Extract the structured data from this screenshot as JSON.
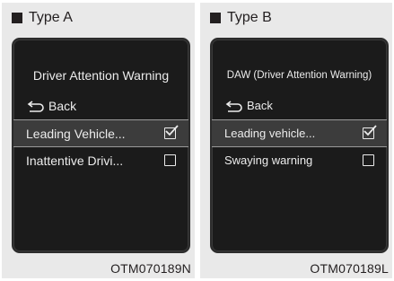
{
  "panels": [
    {
      "type_label": "Type A",
      "screen": {
        "title": "Driver Attention Warning",
        "back_label": "Back",
        "items": [
          {
            "label": "Leading Vehicle...",
            "checked": true,
            "selected": true
          },
          {
            "label": "Inattentive Drivi...",
            "checked": false,
            "selected": false
          }
        ]
      },
      "code": "OTM070189N"
    },
    {
      "type_label": "Type B",
      "screen": {
        "title": "DAW (Driver Attention Warning)",
        "back_label": "Back",
        "items": [
          {
            "label": "Leading vehicle...",
            "checked": true,
            "selected": true
          },
          {
            "label": "Swaying warning",
            "checked": false,
            "selected": false
          }
        ]
      },
      "code": "OTM070189L"
    }
  ],
  "colors": {
    "screen_bg": "#1b1b1b",
    "selected_bg": "#3c3c3c",
    "text_light": "#ececec",
    "text_dark": "#231f20"
  },
  "icons": {
    "header": "black-square-icon",
    "back": "return-arrow-icon",
    "checked": "checkbox-checked-icon",
    "unchecked": "checkbox-unchecked-icon"
  }
}
